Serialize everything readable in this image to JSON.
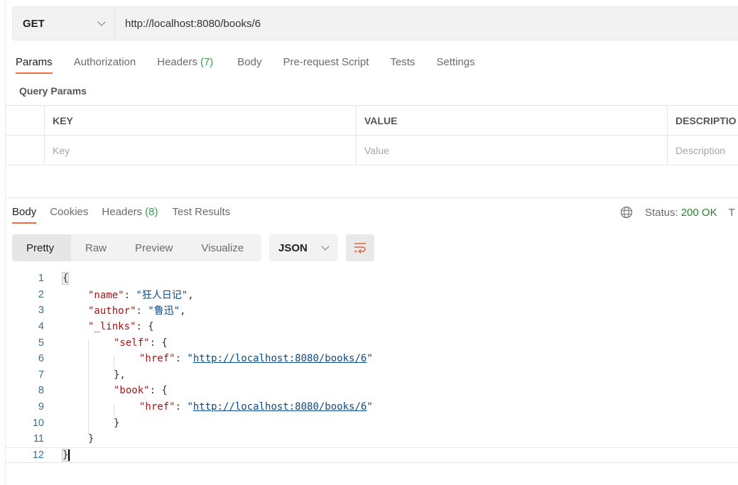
{
  "request": {
    "method": "GET",
    "url": "http://localhost:8080/books/6"
  },
  "request_tabs": [
    {
      "label": "Params",
      "active": true
    },
    {
      "label": "Authorization"
    },
    {
      "label": "Headers",
      "count": "(7)"
    },
    {
      "label": "Body"
    },
    {
      "label": "Pre-request Script"
    },
    {
      "label": "Tests"
    },
    {
      "label": "Settings"
    }
  ],
  "query_params": {
    "title": "Query Params",
    "headers": [
      "KEY",
      "VALUE",
      "DESCRIPTIO"
    ],
    "placeholders": [
      "Key",
      "Value",
      "Description"
    ]
  },
  "response_tabs": [
    {
      "label": "Body",
      "active": true
    },
    {
      "label": "Cookies"
    },
    {
      "label": "Headers",
      "count": "(8)"
    },
    {
      "label": "Test Results"
    }
  ],
  "status": {
    "label": "Status:",
    "value": "200 OK",
    "trailing": "T"
  },
  "view_modes": [
    "Pretty",
    "Raw",
    "Preview",
    "Visualize"
  ],
  "format": "JSON",
  "code_lines": [
    {
      "n": "1",
      "indent": 0,
      "tokens": [
        [
          "b",
          "{"
        ]
      ]
    },
    {
      "n": "2",
      "indent": 1,
      "tokens": [
        [
          "k",
          "\"name\""
        ],
        [
          "p",
          ": "
        ],
        [
          "s",
          "\"狂人日记\""
        ],
        [
          "p",
          ","
        ]
      ]
    },
    {
      "n": "3",
      "indent": 1,
      "tokens": [
        [
          "k",
          "\"author\""
        ],
        [
          "p",
          ": "
        ],
        [
          "s",
          "\"鲁迅\""
        ],
        [
          "p",
          ","
        ]
      ]
    },
    {
      "n": "4",
      "indent": 1,
      "tokens": [
        [
          "k",
          "\"_links\""
        ],
        [
          "p",
          ": {"
        ]
      ]
    },
    {
      "n": "5",
      "indent": 2,
      "tokens": [
        [
          "k",
          "\"self\""
        ],
        [
          "p",
          ": {"
        ]
      ]
    },
    {
      "n": "6",
      "indent": 3,
      "tokens": [
        [
          "k",
          "\"href\""
        ],
        [
          "p",
          ": "
        ],
        [
          "s",
          "\""
        ],
        [
          "u",
          "http://localhost:8080/books/6"
        ],
        [
          "s",
          "\""
        ]
      ]
    },
    {
      "n": "7",
      "indent": 2,
      "tokens": [
        [
          "p",
          "},"
        ]
      ]
    },
    {
      "n": "8",
      "indent": 2,
      "tokens": [
        [
          "k",
          "\"book\""
        ],
        [
          "p",
          ": {"
        ]
      ]
    },
    {
      "n": "9",
      "indent": 3,
      "tokens": [
        [
          "k",
          "\"href\""
        ],
        [
          "p",
          ": "
        ],
        [
          "s",
          "\""
        ],
        [
          "u",
          "http://localhost:8080/books/6"
        ],
        [
          "s",
          "\""
        ]
      ]
    },
    {
      "n": "10",
      "indent": 2,
      "tokens": [
        [
          "p",
          "}"
        ]
      ]
    },
    {
      "n": "11",
      "indent": 1,
      "tokens": [
        [
          "p",
          "}"
        ]
      ]
    },
    {
      "n": "12",
      "indent": 0,
      "tokens": [
        [
          "c",
          "}"
        ]
      ]
    }
  ],
  "colors": {
    "accent": "#f26b3a",
    "success": "#3c9b4f",
    "json_key": "#a31515",
    "json_string": "#0b4a8a"
  }
}
